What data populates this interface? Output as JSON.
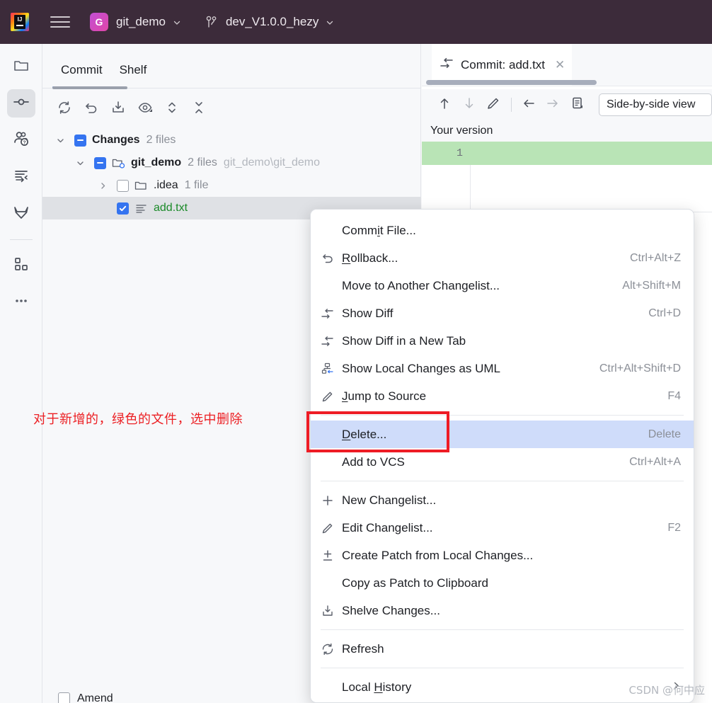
{
  "titlebar": {
    "logo_icon": "intellij-idea-logo",
    "menu_icon": "hamburger-menu-icon",
    "project": {
      "badge": "G",
      "name": "git_demo",
      "chevron_icon": "chevron-down-icon"
    },
    "branch": {
      "icon": "git-branch-icon",
      "name": "dev_V1.0.0_hezy",
      "chevron_icon": "chevron-down-icon"
    }
  },
  "toolstrip": {
    "items": [
      {
        "name": "project-tool-window",
        "icon": "folder-icon",
        "active": false
      },
      {
        "name": "commit-tool-window",
        "icon": "commit-node-icon",
        "active": true
      },
      {
        "name": "pull-requests-tool-window",
        "icon": "people-question-icon",
        "active": false
      },
      {
        "name": "merge-requests-tool-window",
        "icon": "merge-arrows-icon",
        "active": false
      },
      {
        "name": "gitlab-tool-window",
        "icon": "gitlab-fox-icon",
        "active": false
      },
      {
        "name": "plugins-tool-window",
        "icon": "squares-grid-icon",
        "active": false
      },
      {
        "name": "more-tool-windows",
        "icon": "ellipsis-icon",
        "active": false
      }
    ]
  },
  "commit_panel": {
    "tabs": [
      {
        "label": "Commit",
        "active": true
      },
      {
        "label": "Shelf",
        "active": false
      }
    ],
    "toolbar": [
      {
        "name": "refresh-changes-button",
        "icon": "refresh-icon"
      },
      {
        "name": "rollback-button",
        "icon": "rollback-arrow-icon"
      },
      {
        "name": "shelve-changes-button",
        "icon": "shelve-download-icon"
      },
      {
        "name": "show-diff-preview-button",
        "icon": "eye-icon"
      },
      {
        "name": "expand-collapse-button",
        "icon": "up-down-chevron-icon"
      },
      {
        "name": "collapse-all-button",
        "icon": "collapse-all-icon"
      }
    ],
    "tree": [
      {
        "name": "Changes",
        "count": "2 files",
        "path": "",
        "checkbox": "partial",
        "expanded": true,
        "indent": 0,
        "icon": "",
        "style": "bold"
      },
      {
        "name": "git_demo",
        "count": "2 files",
        "path": "git_demo\\git_demo",
        "checkbox": "partial",
        "expanded": true,
        "indent": 1,
        "icon": "module-folder-icon",
        "style": "bold"
      },
      {
        "name": ".idea",
        "count": "1 file",
        "path": "",
        "checkbox": "unchecked",
        "expanded": false,
        "indent": 2,
        "icon": "folder-icon",
        "style": "plain"
      },
      {
        "name": "add.txt",
        "count": "",
        "path": "",
        "checkbox": "checked",
        "expanded": null,
        "indent": 3,
        "icon": "text-file-icon",
        "style": "green",
        "selected": true
      }
    ],
    "annotation": "对于新增的，绿色的文件，选中删除",
    "amend_label": "Amend"
  },
  "diff_panel": {
    "tab": {
      "icon": "diff-arrows-icon",
      "title": "Commit: add.txt",
      "close_icon": "close-icon"
    },
    "toolbar": [
      {
        "name": "previous-difference-button",
        "icon": "arrow-up-icon"
      },
      {
        "name": "next-difference-button",
        "icon": "arrow-down-icon"
      },
      {
        "name": "edit-source-button",
        "icon": "pencil-icon"
      },
      {
        "name": "accept-left-button",
        "icon": "arrow-left-icon"
      },
      {
        "name": "accept-right-button",
        "icon": "arrow-right-icon"
      },
      {
        "name": "diff-settings-button",
        "icon": "document-settings-icon"
      }
    ],
    "view_mode": "Side-by-side view",
    "version_label": "Your version",
    "line_numbers": [
      "1"
    ]
  },
  "context_menu": {
    "items": [
      {
        "label": "Commit File...",
        "mnemonic": "i",
        "shortcut": "",
        "icon": "",
        "type": "item"
      },
      {
        "label": "Rollback...",
        "mnemonic": "R",
        "shortcut": "Ctrl+Alt+Z",
        "icon": "rollback-arrow-icon",
        "type": "item"
      },
      {
        "label": "Move to Another Changelist...",
        "mnemonic": "",
        "shortcut": "Alt+Shift+M",
        "icon": "",
        "type": "item"
      },
      {
        "label": "Show Diff",
        "mnemonic": "",
        "shortcut": "Ctrl+D",
        "icon": "diff-arrows-icon",
        "type": "item"
      },
      {
        "label": "Show Diff in a New Tab",
        "mnemonic": "",
        "shortcut": "",
        "icon": "diff-arrows-icon",
        "type": "item"
      },
      {
        "label": "Show Local Changes as UML",
        "mnemonic": "",
        "shortcut": "Ctrl+Alt+Shift+D",
        "icon": "uml-diagram-icon",
        "type": "item"
      },
      {
        "label": "Jump to Source",
        "mnemonic": "J",
        "shortcut": "F4",
        "icon": "pencil-icon",
        "type": "item"
      },
      {
        "type": "separator"
      },
      {
        "label": "Delete...",
        "mnemonic": "D",
        "shortcut": "Delete",
        "icon": "",
        "type": "item",
        "highlighted": true
      },
      {
        "label": "Add to VCS",
        "mnemonic": "",
        "shortcut": "Ctrl+Alt+A",
        "icon": "",
        "type": "item"
      },
      {
        "type": "separator"
      },
      {
        "label": "New Changelist...",
        "mnemonic": "",
        "shortcut": "",
        "icon": "plus-icon",
        "type": "item"
      },
      {
        "label": "Edit Changelist...",
        "mnemonic": "",
        "shortcut": "F2",
        "icon": "pencil-icon",
        "type": "item"
      },
      {
        "label": "Create Patch from Local Changes...",
        "mnemonic": "",
        "shortcut": "",
        "icon": "create-patch-icon",
        "type": "item"
      },
      {
        "label": "Copy as Patch to Clipboard",
        "mnemonic": "",
        "shortcut": "",
        "icon": "",
        "type": "item"
      },
      {
        "label": "Shelve Changes...",
        "mnemonic": "",
        "shortcut": "",
        "icon": "shelve-download-icon",
        "type": "item"
      },
      {
        "type": "separator"
      },
      {
        "label": "Refresh",
        "mnemonic": "",
        "shortcut": "",
        "icon": "refresh-icon",
        "type": "item"
      },
      {
        "type": "separator"
      },
      {
        "label": "Local History",
        "mnemonic": "H",
        "shortcut": "",
        "icon": "",
        "type": "submenu",
        "submenu_arrow": "chevron-right-icon"
      }
    ]
  },
  "watermark": "CSDN @何中应",
  "colors": {
    "titlebar_bg": "#3c2b3a",
    "accent_blue": "#3574f0",
    "menu_highlight": "#cfdcfa",
    "annotation_red": "#ec2024",
    "added_line_green": "#b9e4b6",
    "added_file_green": "#1a8a28"
  }
}
